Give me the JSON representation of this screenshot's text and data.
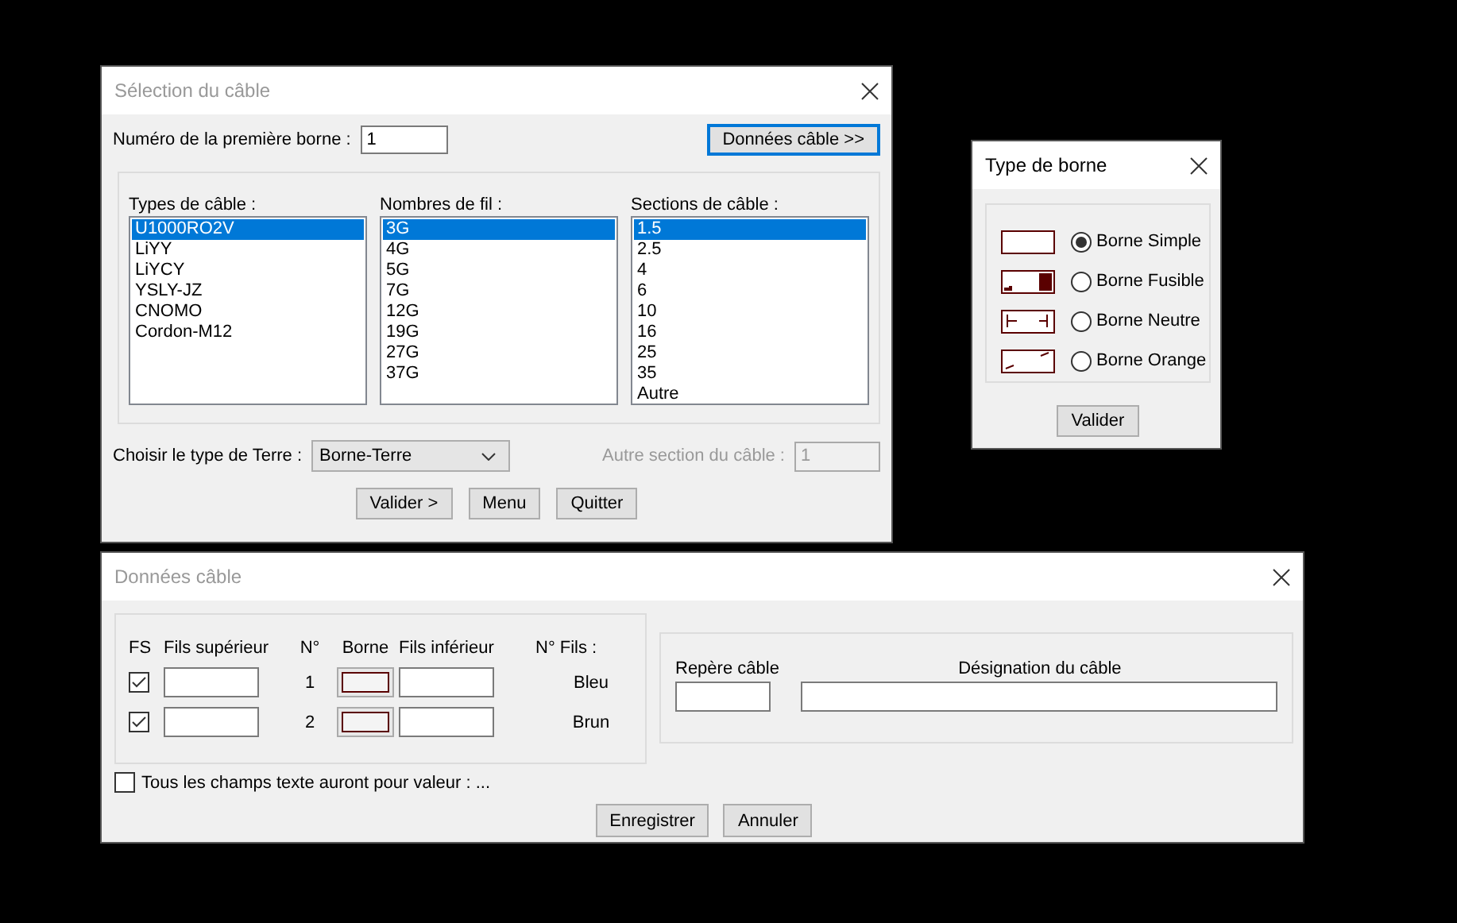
{
  "cable_selection": {
    "title": "Sélection du câble",
    "first_terminal": {
      "label": "Numéro de la première borne :",
      "value": "1"
    },
    "data_button": {
      "label": "Données câble >>",
      "focused": true
    },
    "lists": [
      {
        "label": "Types de câble :",
        "items": [
          {
            "text": "U1000RO2V",
            "selected": true
          },
          {
            "text": "LiYY",
            "selected": false
          },
          {
            "text": "LiYCY",
            "selected": false
          },
          {
            "text": "YSLY-JZ",
            "selected": false
          },
          {
            "text": "CNOMO",
            "selected": false
          },
          {
            "text": "Cordon-M12",
            "selected": false
          }
        ]
      },
      {
        "label": "Nombres de fil :",
        "items": [
          {
            "text": "3G",
            "selected": true
          },
          {
            "text": "4G",
            "selected": false
          },
          {
            "text": "5G",
            "selected": false
          },
          {
            "text": "7G",
            "selected": false
          },
          {
            "text": "12G",
            "selected": false
          },
          {
            "text": "19G",
            "selected": false
          },
          {
            "text": "27G",
            "selected": false
          },
          {
            "text": "37G",
            "selected": false
          }
        ]
      },
      {
        "label": "Sections de câble :",
        "items": [
          {
            "text": "1.5",
            "selected": true
          },
          {
            "text": "2.5",
            "selected": false
          },
          {
            "text": "4",
            "selected": false
          },
          {
            "text": "6",
            "selected": false
          },
          {
            "text": "10",
            "selected": false
          },
          {
            "text": "16",
            "selected": false
          },
          {
            "text": "25",
            "selected": false
          },
          {
            "text": "35",
            "selected": false
          },
          {
            "text": "Autre",
            "selected": false
          }
        ]
      }
    ],
    "earth": {
      "label": "Choisir le type de Terre :",
      "value": "Borne-Terre"
    },
    "other_section": {
      "label": "Autre section du câble :",
      "value": "1",
      "disabled": true
    },
    "buttons": [
      "Valider >",
      "Menu",
      "Quitter"
    ]
  },
  "terminal_type": {
    "title": "Type de borne",
    "options": [
      {
        "kind": "simple",
        "label": "Borne Simple",
        "selected": true
      },
      {
        "kind": "fuse",
        "label": "Borne Fusible",
        "selected": false
      },
      {
        "kind": "neutral",
        "label": "Borne Neutre",
        "selected": false
      },
      {
        "kind": "orange",
        "label": "Borne Orange",
        "selected": false
      }
    ],
    "button": "Valider"
  },
  "cable_data": {
    "title": "Données câble",
    "columns": [
      "FS",
      "Fils supérieur",
      "N°",
      "Borne",
      "Fils inférieur",
      "N° Fils :"
    ],
    "rows": [
      {
        "checked": true,
        "number": "1",
        "wire": "Bleu"
      },
      {
        "checked": true,
        "number": "2",
        "wire": "Brun"
      }
    ],
    "all_fields": {
      "label": "Tous les champs texte auront pour valeur : ...",
      "checked": false
    },
    "cable_fields": [
      {
        "label": "Repère câble"
      },
      {
        "label": "Désignation du câble"
      }
    ],
    "buttons": [
      "Enregistrer",
      "Annuler"
    ]
  }
}
